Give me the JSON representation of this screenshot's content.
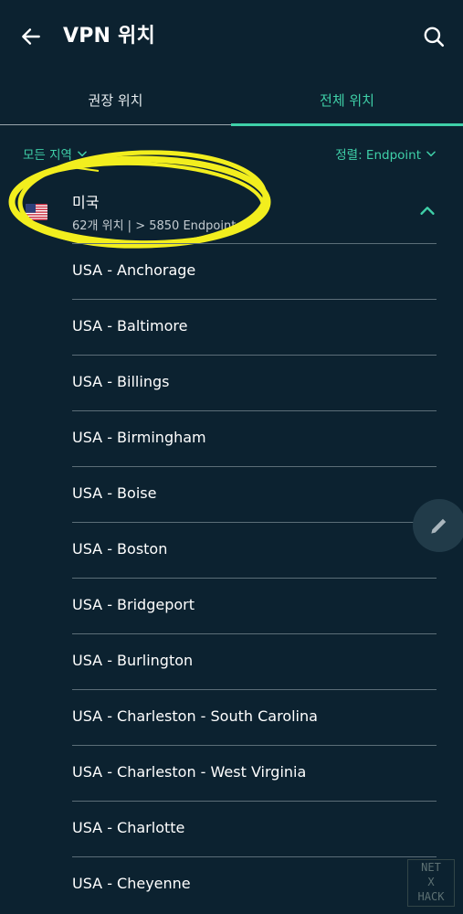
{
  "header": {
    "title": "VPN 위치",
    "back_icon": "arrow-left-icon",
    "search_icon": "search-icon"
  },
  "tabs": [
    {
      "label": "권장 위치",
      "selected": false
    },
    {
      "label": "전체 위치",
      "selected": true
    }
  ],
  "filters": {
    "region_label": "모든 지역",
    "sort_label": "정렬: Endpoint"
  },
  "country": {
    "name": "미국",
    "subtitle": "62개 위치 | > 5850 Endpoint",
    "flag": "us-flag-icon",
    "expanded": true
  },
  "cities": [
    "USA - Anchorage",
    "USA - Baltimore",
    "USA - Billings",
    "USA - Birmingham",
    "USA - Boise",
    "USA - Boston",
    "USA - Bridgeport",
    "USA - Burlington",
    "USA - Charleston - South Carolina",
    "USA - Charleston - West Virginia",
    "USA - Charlotte",
    "USA - Cheyenne"
  ],
  "watermark": {
    "line1": "NET",
    "line2": "X",
    "line3": "HACK"
  },
  "colors": {
    "background": "#0c2230",
    "accent": "#3fd0a8",
    "highlight": "#f2ee1e",
    "divider": "#5c6e78"
  }
}
